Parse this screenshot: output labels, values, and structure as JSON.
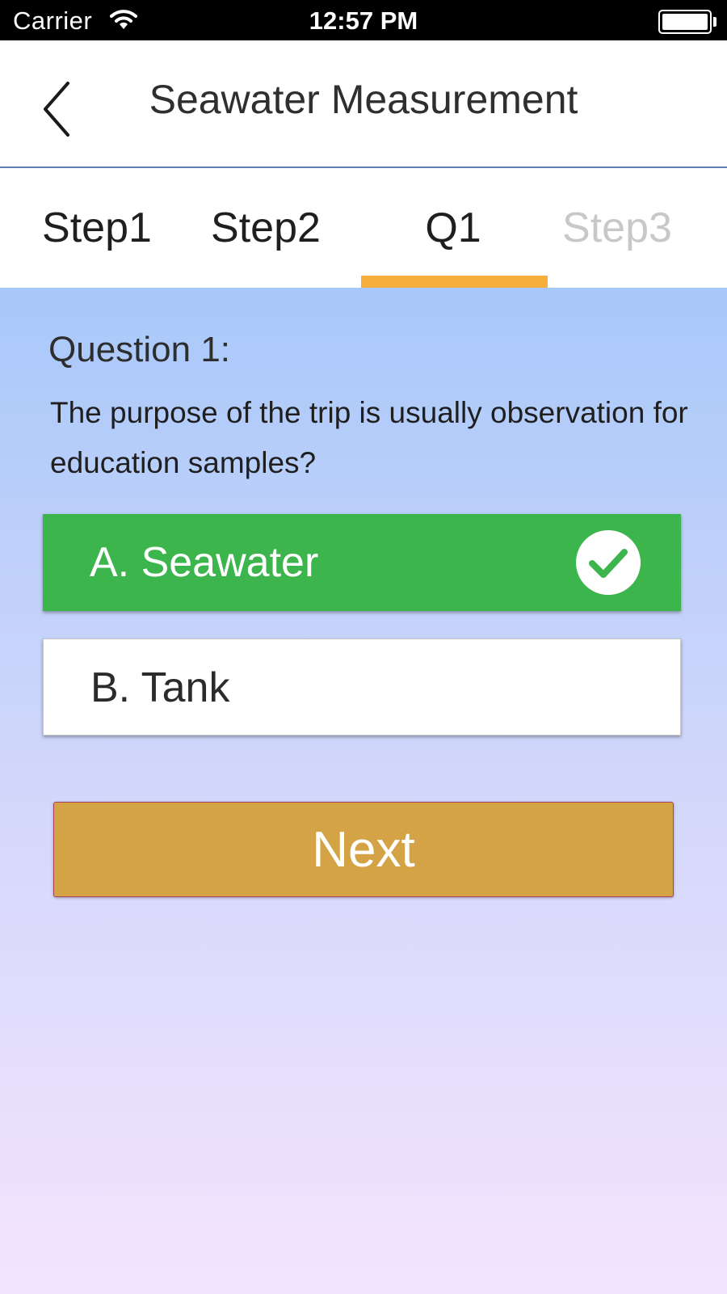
{
  "status_bar": {
    "carrier": "Carrier",
    "time": "12:57 PM",
    "icons": [
      "wifi-icon",
      "battery-icon"
    ]
  },
  "nav": {
    "title": "Seawater Measurement",
    "back_icon": "chevron-left-icon"
  },
  "tabs": [
    {
      "label": "Step1",
      "state": "normal"
    },
    {
      "label": "Step2",
      "state": "normal"
    },
    {
      "label": "Q1",
      "state": "active"
    },
    {
      "label": "Step3",
      "state": "disabled"
    }
  ],
  "question": {
    "heading": "Question 1:",
    "text": "The purpose of the trip is usually observation for education samples?"
  },
  "options": [
    {
      "label": "A. Seawater",
      "selected": true,
      "icon": "checkmark-icon"
    },
    {
      "label": "B. Tank",
      "selected": false
    }
  ],
  "next_button": {
    "label": "Next"
  },
  "colors": {
    "accent_tab": "#f7ae3b",
    "selected_option": "#3db54d",
    "next_button": "#d3a346",
    "background_top": "#a8c8fa",
    "background_bottom": "#f4e4fd"
  }
}
